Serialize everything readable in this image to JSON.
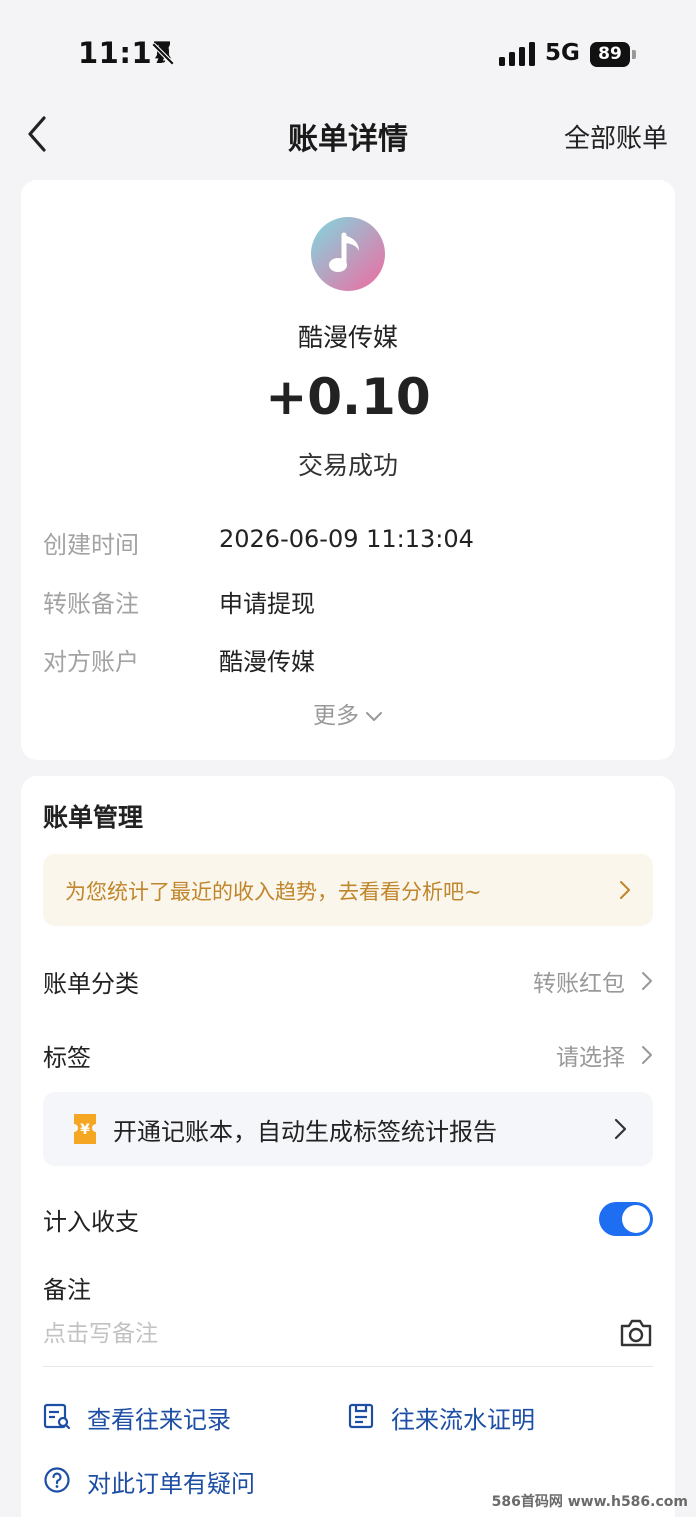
{
  "status_bar": {
    "time": "11:17",
    "network": "5G",
    "battery": "89"
  },
  "nav": {
    "title": "账单详情",
    "right_action": "全部账单"
  },
  "transaction": {
    "merchant_name": "酷漫传媒",
    "amount": "+0.10",
    "status": "交易成功",
    "logo_colors": [
      "#7fd8e0",
      "#f06aa0"
    ],
    "details": [
      {
        "label": "创建时间",
        "value": "2026-06-09 11:13:04"
      },
      {
        "label": "转账备注",
        "value": "申请提现"
      },
      {
        "label": "对方账户",
        "value": "酷漫传媒"
      }
    ],
    "more_label": "更多"
  },
  "management": {
    "title": "账单管理",
    "tip_banner": "为您统计了最近的收入趋势，去看看分析吧~",
    "category": {
      "label": "账单分类",
      "value": "转账红包"
    },
    "tag": {
      "label": "标签",
      "value": "请选择"
    },
    "ledger_banner": "开通记账本，自动生成标签统计报告",
    "count_toggle": {
      "label": "计入收支",
      "enabled": true
    },
    "remark": {
      "label": "备注",
      "placeholder": "点击写备注"
    },
    "links": {
      "history": "查看往来记录",
      "proof": "往来流水证明",
      "question": "对此订单有疑问"
    }
  },
  "watermark": "586首码网 www.h586.com",
  "colors": {
    "accent": "#1e6ef2",
    "link": "#1d4ea5",
    "tip_text": "#c0862b",
    "tip_bg": "#fbf6ec"
  }
}
